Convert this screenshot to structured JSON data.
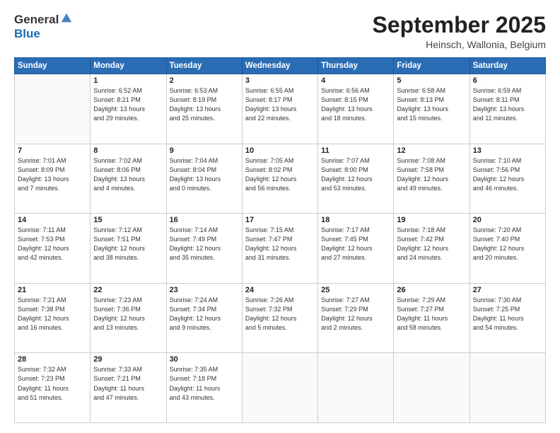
{
  "logo": {
    "general": "General",
    "blue": "Blue"
  },
  "header": {
    "month": "September 2025",
    "location": "Heinsch, Wallonia, Belgium"
  },
  "days_of_week": [
    "Sunday",
    "Monday",
    "Tuesday",
    "Wednesday",
    "Thursday",
    "Friday",
    "Saturday"
  ],
  "weeks": [
    [
      {
        "day": "",
        "info": ""
      },
      {
        "day": "1",
        "info": "Sunrise: 6:52 AM\nSunset: 8:21 PM\nDaylight: 13 hours\nand 29 minutes."
      },
      {
        "day": "2",
        "info": "Sunrise: 6:53 AM\nSunset: 8:19 PM\nDaylight: 13 hours\nand 25 minutes."
      },
      {
        "day": "3",
        "info": "Sunrise: 6:55 AM\nSunset: 8:17 PM\nDaylight: 13 hours\nand 22 minutes."
      },
      {
        "day": "4",
        "info": "Sunrise: 6:56 AM\nSunset: 8:15 PM\nDaylight: 13 hours\nand 18 minutes."
      },
      {
        "day": "5",
        "info": "Sunrise: 6:58 AM\nSunset: 8:13 PM\nDaylight: 13 hours\nand 15 minutes."
      },
      {
        "day": "6",
        "info": "Sunrise: 6:59 AM\nSunset: 8:11 PM\nDaylight: 13 hours\nand 11 minutes."
      }
    ],
    [
      {
        "day": "7",
        "info": "Sunrise: 7:01 AM\nSunset: 8:09 PM\nDaylight: 13 hours\nand 7 minutes."
      },
      {
        "day": "8",
        "info": "Sunrise: 7:02 AM\nSunset: 8:06 PM\nDaylight: 13 hours\nand 4 minutes."
      },
      {
        "day": "9",
        "info": "Sunrise: 7:04 AM\nSunset: 8:04 PM\nDaylight: 13 hours\nand 0 minutes."
      },
      {
        "day": "10",
        "info": "Sunrise: 7:05 AM\nSunset: 8:02 PM\nDaylight: 12 hours\nand 56 minutes."
      },
      {
        "day": "11",
        "info": "Sunrise: 7:07 AM\nSunset: 8:00 PM\nDaylight: 12 hours\nand 53 minutes."
      },
      {
        "day": "12",
        "info": "Sunrise: 7:08 AM\nSunset: 7:58 PM\nDaylight: 12 hours\nand 49 minutes."
      },
      {
        "day": "13",
        "info": "Sunrise: 7:10 AM\nSunset: 7:56 PM\nDaylight: 12 hours\nand 46 minutes."
      }
    ],
    [
      {
        "day": "14",
        "info": "Sunrise: 7:11 AM\nSunset: 7:53 PM\nDaylight: 12 hours\nand 42 minutes."
      },
      {
        "day": "15",
        "info": "Sunrise: 7:12 AM\nSunset: 7:51 PM\nDaylight: 12 hours\nand 38 minutes."
      },
      {
        "day": "16",
        "info": "Sunrise: 7:14 AM\nSunset: 7:49 PM\nDaylight: 12 hours\nand 35 minutes."
      },
      {
        "day": "17",
        "info": "Sunrise: 7:15 AM\nSunset: 7:47 PM\nDaylight: 12 hours\nand 31 minutes."
      },
      {
        "day": "18",
        "info": "Sunrise: 7:17 AM\nSunset: 7:45 PM\nDaylight: 12 hours\nand 27 minutes."
      },
      {
        "day": "19",
        "info": "Sunrise: 7:18 AM\nSunset: 7:42 PM\nDaylight: 12 hours\nand 24 minutes."
      },
      {
        "day": "20",
        "info": "Sunrise: 7:20 AM\nSunset: 7:40 PM\nDaylight: 12 hours\nand 20 minutes."
      }
    ],
    [
      {
        "day": "21",
        "info": "Sunrise: 7:21 AM\nSunset: 7:38 PM\nDaylight: 12 hours\nand 16 minutes."
      },
      {
        "day": "22",
        "info": "Sunrise: 7:23 AM\nSunset: 7:36 PM\nDaylight: 12 hours\nand 13 minutes."
      },
      {
        "day": "23",
        "info": "Sunrise: 7:24 AM\nSunset: 7:34 PM\nDaylight: 12 hours\nand 9 minutes."
      },
      {
        "day": "24",
        "info": "Sunrise: 7:26 AM\nSunset: 7:32 PM\nDaylight: 12 hours\nand 5 minutes."
      },
      {
        "day": "25",
        "info": "Sunrise: 7:27 AM\nSunset: 7:29 PM\nDaylight: 12 hours\nand 2 minutes."
      },
      {
        "day": "26",
        "info": "Sunrise: 7:29 AM\nSunset: 7:27 PM\nDaylight: 11 hours\nand 58 minutes."
      },
      {
        "day": "27",
        "info": "Sunrise: 7:30 AM\nSunset: 7:25 PM\nDaylight: 11 hours\nand 54 minutes."
      }
    ],
    [
      {
        "day": "28",
        "info": "Sunrise: 7:32 AM\nSunset: 7:23 PM\nDaylight: 11 hours\nand 51 minutes."
      },
      {
        "day": "29",
        "info": "Sunrise: 7:33 AM\nSunset: 7:21 PM\nDaylight: 11 hours\nand 47 minutes."
      },
      {
        "day": "30",
        "info": "Sunrise: 7:35 AM\nSunset: 7:18 PM\nDaylight: 11 hours\nand 43 minutes."
      },
      {
        "day": "",
        "info": ""
      },
      {
        "day": "",
        "info": ""
      },
      {
        "day": "",
        "info": ""
      },
      {
        "day": "",
        "info": ""
      }
    ]
  ]
}
